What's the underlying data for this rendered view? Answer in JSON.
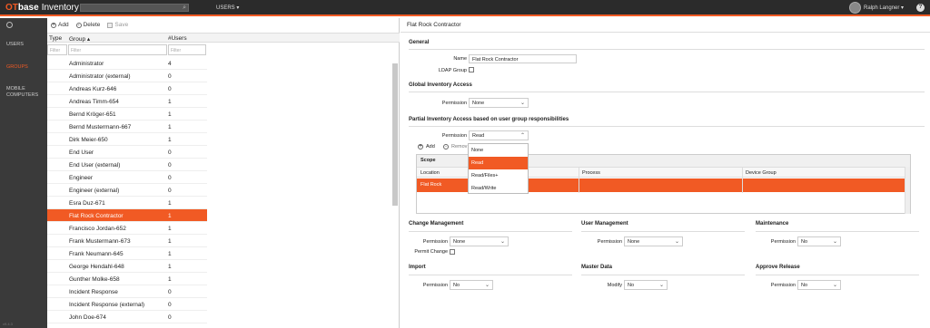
{
  "topbar": {
    "logo_ot": "OT",
    "logo_base": "base",
    "app_name": "Inventory",
    "users_menu": "USERS ▾",
    "user_name": "Ralph Langner ▾",
    "help": "?"
  },
  "sidebar": {
    "items": [
      "USERS",
      "GROUPS",
      "MOBILE COMPUTERS"
    ],
    "active": "GROUPS",
    "version": "v9.4.3"
  },
  "toolbar": {
    "add": "Add",
    "delete": "Delete",
    "save": "Save"
  },
  "table": {
    "columns": {
      "type": "Type",
      "group": "Group ▴",
      "users": "#Users"
    },
    "filter_placeholder": "Filter",
    "rows": [
      {
        "name": "Administrator",
        "count": "4"
      },
      {
        "name": "Administrator (external)",
        "count": "0"
      },
      {
        "name": "Andreas Kurz-646",
        "count": "0"
      },
      {
        "name": "Andreas Timm-654",
        "count": "1"
      },
      {
        "name": "Bernd Kröger-651",
        "count": "1"
      },
      {
        "name": "Bernd Mustermann-667",
        "count": "1"
      },
      {
        "name": "Dirk Meier-650",
        "count": "1"
      },
      {
        "name": "End User",
        "count": "0"
      },
      {
        "name": "End User (external)",
        "count": "0"
      },
      {
        "name": "Engineer",
        "count": "0"
      },
      {
        "name": "Engineer (external)",
        "count": "0"
      },
      {
        "name": "Esra Duz-671",
        "count": "1"
      },
      {
        "name": "Flat Rock Contractor",
        "count": "1"
      },
      {
        "name": "Francisco Jordan-652",
        "count": "1"
      },
      {
        "name": "Frank Mustermann-673",
        "count": "1"
      },
      {
        "name": "Frank Neumann-645",
        "count": "1"
      },
      {
        "name": "George Hendahl-648",
        "count": "1"
      },
      {
        "name": "Gunther Molke-658",
        "count": "1"
      },
      {
        "name": "Incident Response",
        "count": "0"
      },
      {
        "name": "Incident Response (external)",
        "count": "0"
      },
      {
        "name": "John Doe-674",
        "count": "0"
      }
    ],
    "selected_index": 12
  },
  "detail": {
    "title": "Flat Rock Contractor",
    "general": "General",
    "name_label": "Name",
    "name_value": "Flat Rock Contractor",
    "ldap_label": "LDAP Group",
    "global": "Global Inventory Access",
    "permission_label": "Permission",
    "global_permission": "None",
    "partial": "Partial Inventory Access based on user group responsibilities",
    "partial_permission": "Read",
    "dropdown_options": [
      "None",
      "Read",
      "Read/Files+",
      "Read/Write"
    ],
    "dropdown_selected": "Read",
    "add": "Add",
    "remove": "Remov",
    "scope": "Scope",
    "grid_columns": [
      "Location",
      "Process",
      "Device Group"
    ],
    "grid_row": "Flat Rock",
    "change_mgmt": "Change Management",
    "user_mgmt": "User Management",
    "maintenance": "Maintenance",
    "cm_permission": "None",
    "permit_change": "Permit Change",
    "um_permission": "None",
    "mt_permission": "No",
    "import": "Import",
    "master_data": "Master Data",
    "approve_release": "Approve Release",
    "import_permission": "No",
    "modify_label": "Modify",
    "md_modify": "No",
    "ar_permission": "No"
  },
  "colors": {
    "accent": "#f15a24",
    "topbar": "#2b2b2b",
    "sidebar": "#3a3a3a"
  }
}
